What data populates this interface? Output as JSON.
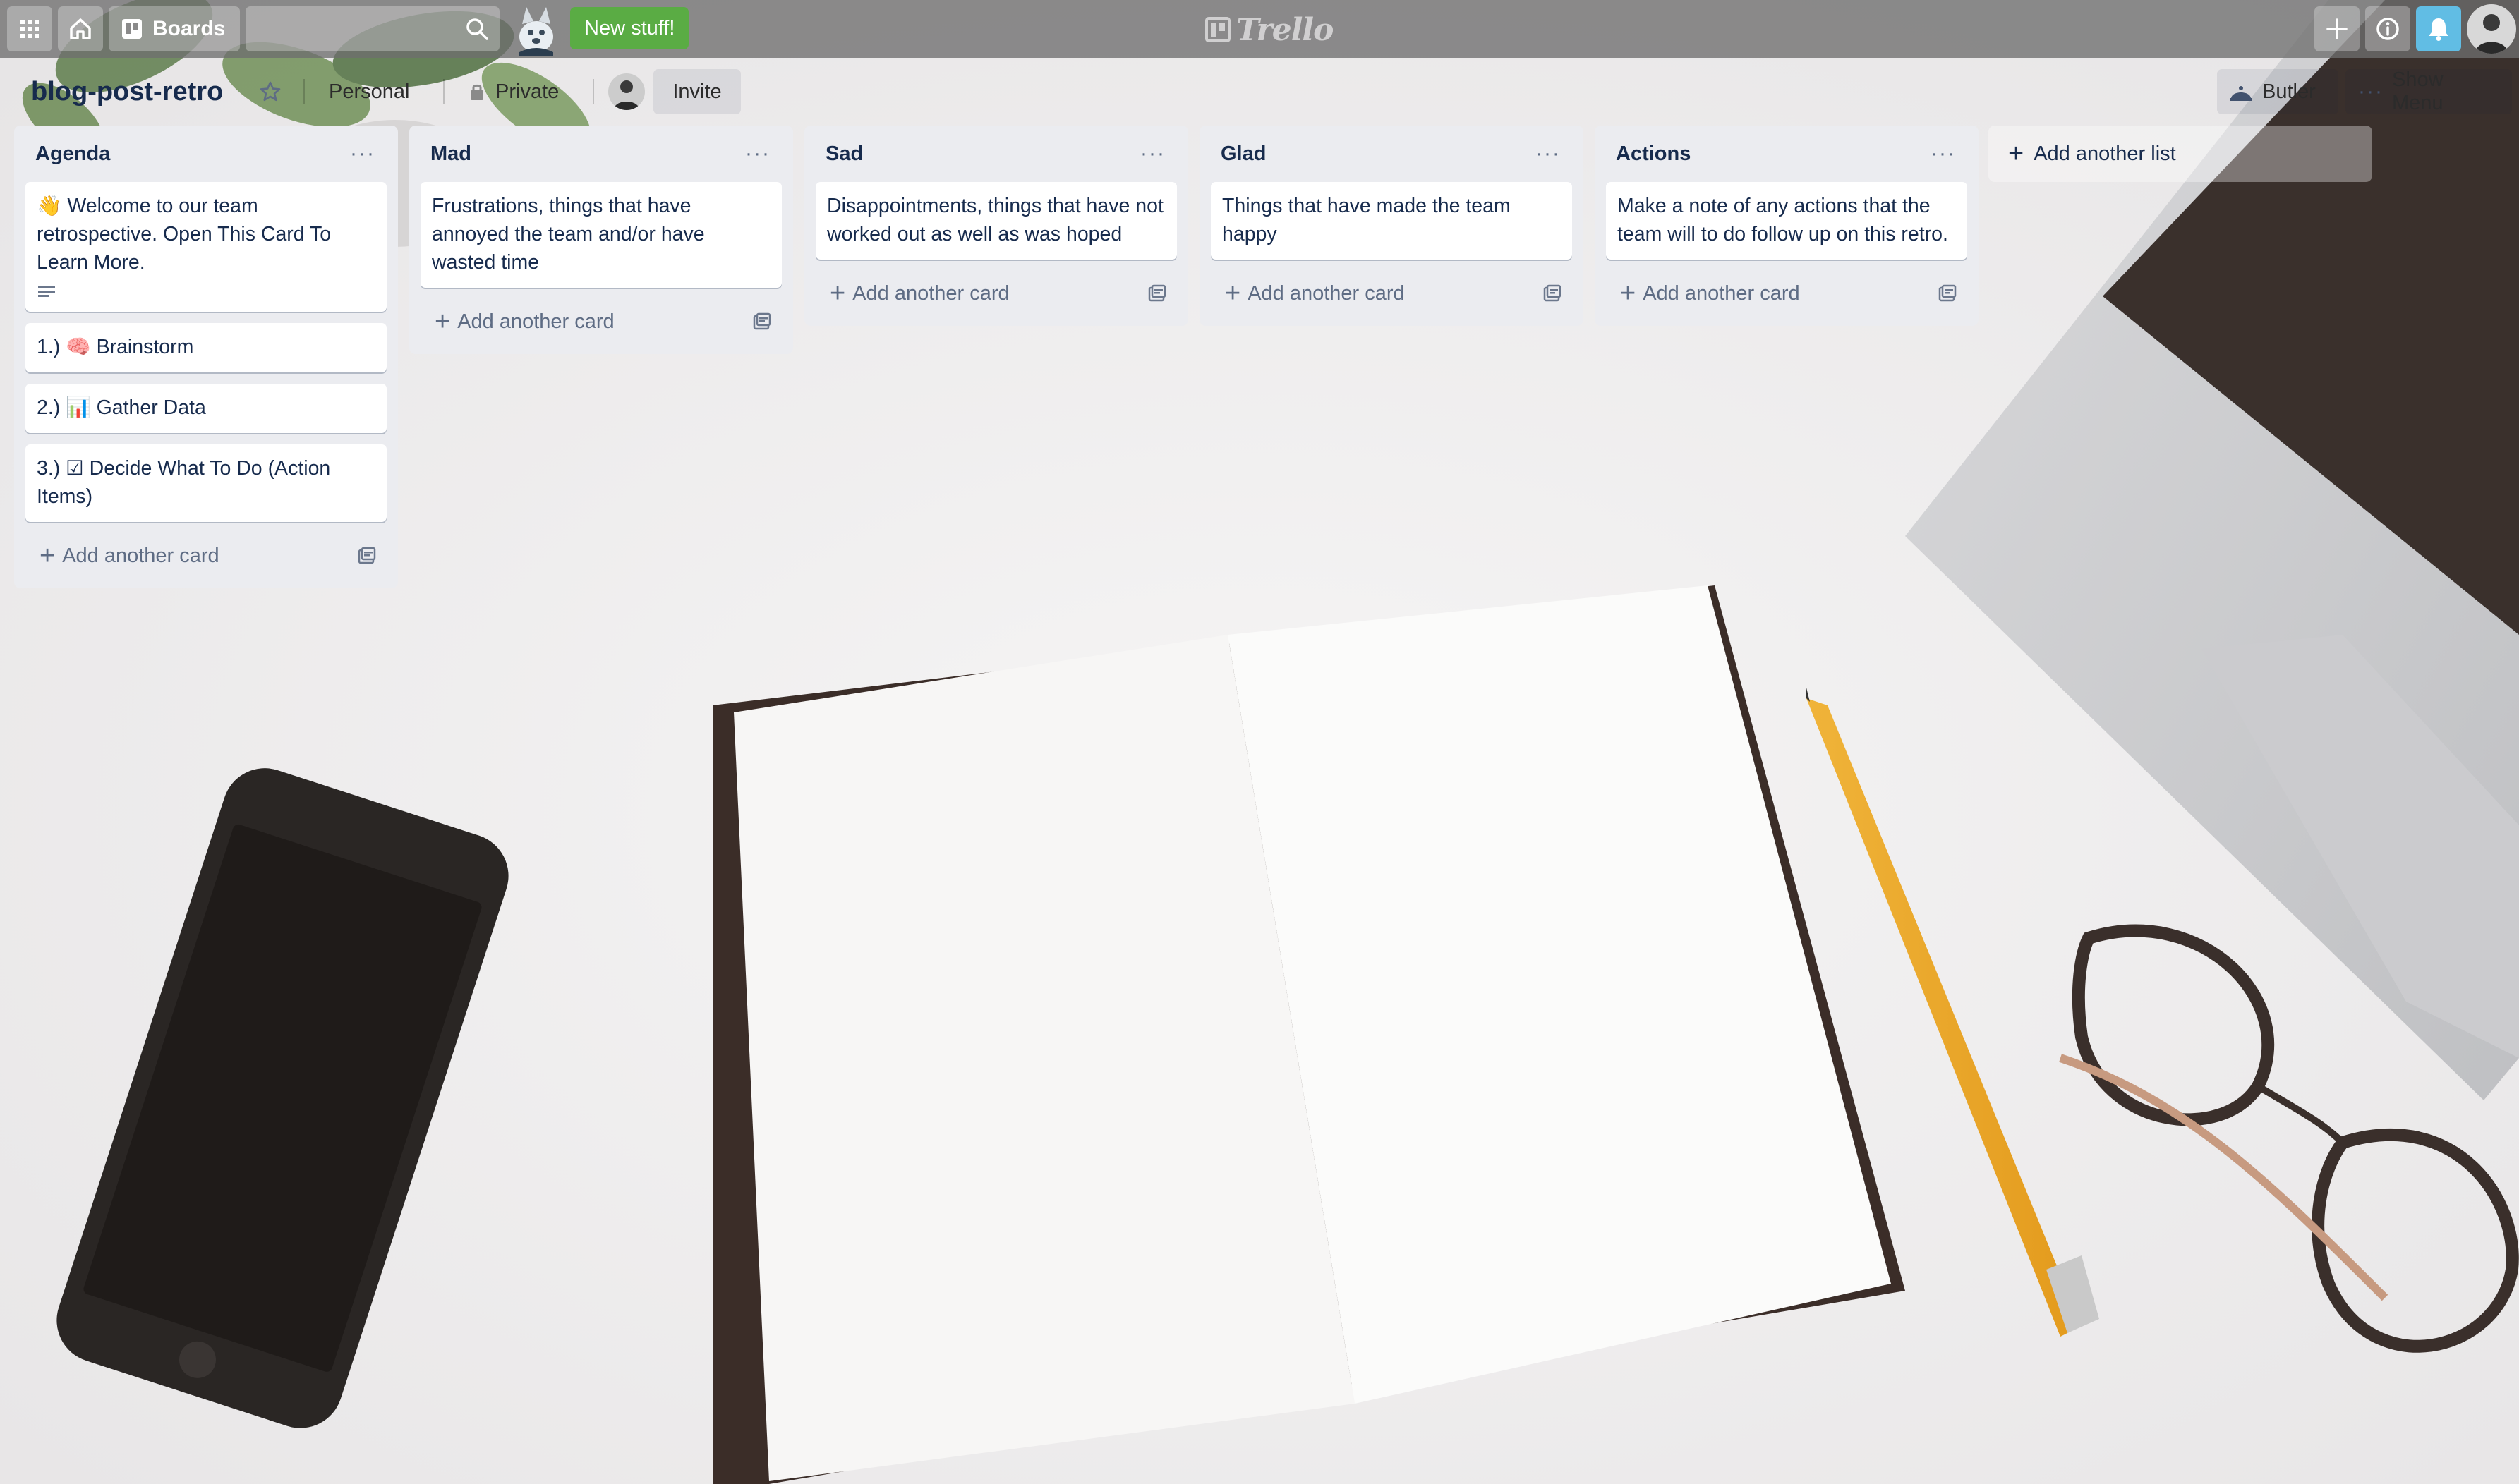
{
  "nav": {
    "boards_label": "Boards",
    "search_placeholder": "",
    "new_stuff_label": "New stuff!",
    "logo_text": "Trello"
  },
  "board": {
    "title": "blog-post-retro",
    "team_label": "Personal",
    "visibility_label": "Private",
    "invite_label": "Invite",
    "butler_label": "Butler",
    "show_menu_label": "Show Menu"
  },
  "lists": [
    {
      "title": "Agenda",
      "cards": [
        {
          "text": "👋 Welcome to our team retrospective. Open This Card To Learn More.",
          "has_description": true
        },
        {
          "text": "1.) 🧠 Brainstorm"
        },
        {
          "text": "2.) 📊 Gather Data"
        },
        {
          "text": "3.) ☑ Decide What To Do (Action Items)"
        }
      ],
      "add_card_label": "Add another card"
    },
    {
      "title": "Mad",
      "cards": [
        {
          "text": "Frustrations, things that have annoyed the team and/or have wasted time"
        }
      ],
      "add_card_label": "Add another card"
    },
    {
      "title": "Sad",
      "cards": [
        {
          "text": "Disappointments, things that have not worked out as well as was hoped"
        }
      ],
      "add_card_label": "Add another card"
    },
    {
      "title": "Glad",
      "cards": [
        {
          "text": "Things that have made the team happy"
        }
      ],
      "add_card_label": "Add another card"
    },
    {
      "title": "Actions",
      "cards": [
        {
          "text": "Make a note of any actions that the team will to do follow up on this retro."
        }
      ],
      "add_card_label": "Add another card"
    }
  ],
  "add_list_label": "Add another list",
  "colors": {
    "nav_bg": "#6e6e6e",
    "new_stuff_green": "#5aac44",
    "list_bg": "#ebecf0",
    "text_primary": "#172b4d",
    "text_muted": "#5e6c84",
    "notification_blue": "#61bde4"
  },
  "icons": {
    "apps": "app-switcher-icon",
    "home": "home-icon",
    "boards": "boards-icon",
    "search": "search-icon",
    "create": "plus-icon",
    "info": "info-icon",
    "notifications": "bell-icon",
    "star": "star-icon",
    "template": "card-template-icon",
    "description": "description-icon"
  }
}
